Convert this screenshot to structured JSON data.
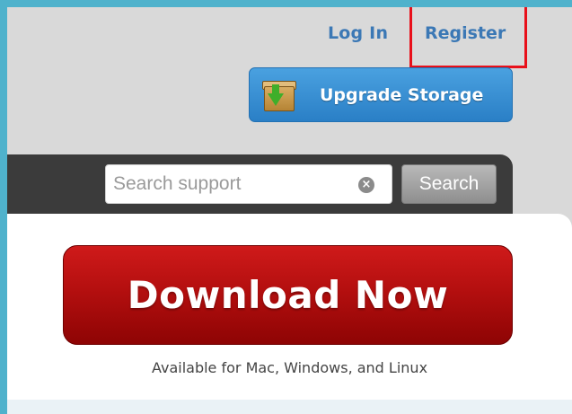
{
  "header": {
    "login_label": "Log In",
    "register_label": "Register"
  },
  "upgrade": {
    "label": "Upgrade Storage",
    "icon": "storage-box-download-icon"
  },
  "search": {
    "placeholder": "Search support",
    "button_label": "Search",
    "clear_icon": "clear-icon"
  },
  "main": {
    "download_label": "Download Now",
    "availability_text": "Available for Mac, Windows, and Linux"
  },
  "colors": {
    "frame": "#4fb2cc",
    "link": "#3b78b5",
    "highlight": "#e8101a",
    "upgrade_button": "#2a7fc6",
    "download_button": "#b40f0f",
    "search_bar": "#3b3b3b"
  }
}
